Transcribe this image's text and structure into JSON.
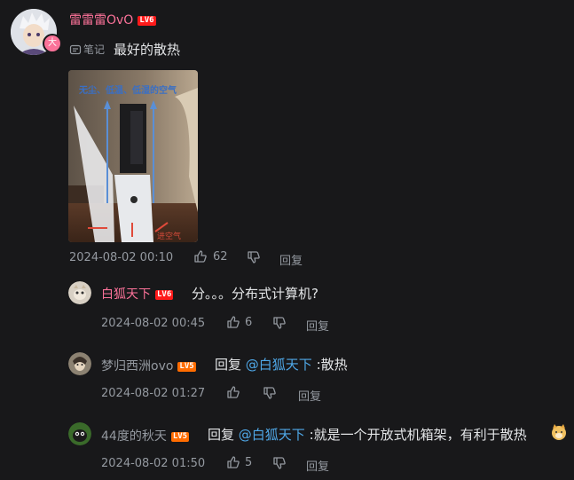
{
  "main_comment": {
    "user": "雷雷雷OvO",
    "level": "LV6",
    "avatar_badge": "大",
    "note_tag": "笔记",
    "text": "最好的散热",
    "image_caption": "无尘、低温、低湿的空气",
    "image_label": "进空气",
    "time": "2024-08-02 00:10",
    "likes": "62",
    "reply": "回复"
  },
  "replies": [
    {
      "user": "白狐天下",
      "level": "LV6",
      "text": "分。。。分布式计算机?",
      "mention": "",
      "time": "2024-08-02 00:45",
      "likes": "6",
      "reply": "回复"
    },
    {
      "user": "梦归西洲ovo",
      "level": "LV5",
      "prefix": "回复",
      "mention": "@白狐天下",
      "text": ":散热",
      "time": "2024-08-02 01:27",
      "likes": "",
      "reply": "回复"
    },
    {
      "user": "44度的秋天",
      "level": "LV5",
      "prefix": "回复",
      "mention": "@白狐天下",
      "text": ":就是一个开放式机箱架，有利于散热",
      "time": "2024-08-02 01:50",
      "likes": "5",
      "reply": "回复"
    }
  ],
  "colors": {
    "background": "#18181a",
    "vip_name": "#fb7299",
    "mention": "#4fa8e8",
    "lv6": "#ff1a1a",
    "lv5": "#ff6c00"
  }
}
